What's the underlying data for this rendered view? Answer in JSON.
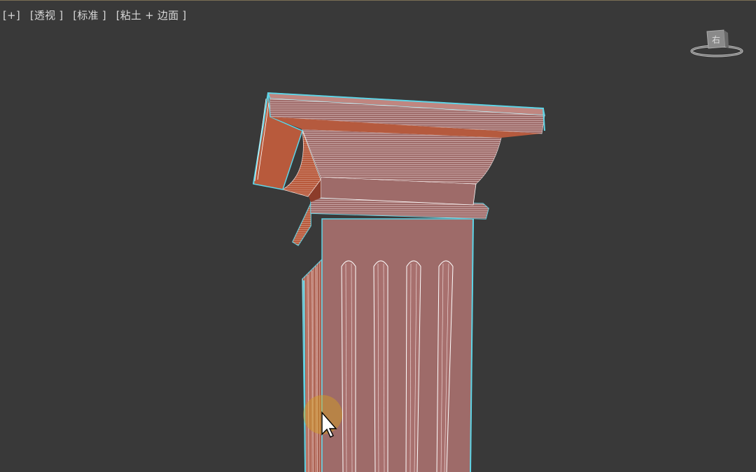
{
  "viewport": {
    "labels": {
      "plus": "[+]",
      "view": "[透视 ]",
      "shading": "[标准 ]",
      "style": "[粘土 + 边面 ]"
    },
    "viewcube": {
      "face_label": "右"
    }
  },
  "colors": {
    "background": "#393939",
    "clay_front": "#9e6b69",
    "clay_side": "#b85a3c",
    "selection_outline": "#5fd4e6",
    "edge_lines": "#ffffff",
    "cursor_highlight": "#d4a21e"
  },
  "icons": {
    "viewcube": "viewcube-icon",
    "cursor": "mouse-pointer-icon"
  }
}
